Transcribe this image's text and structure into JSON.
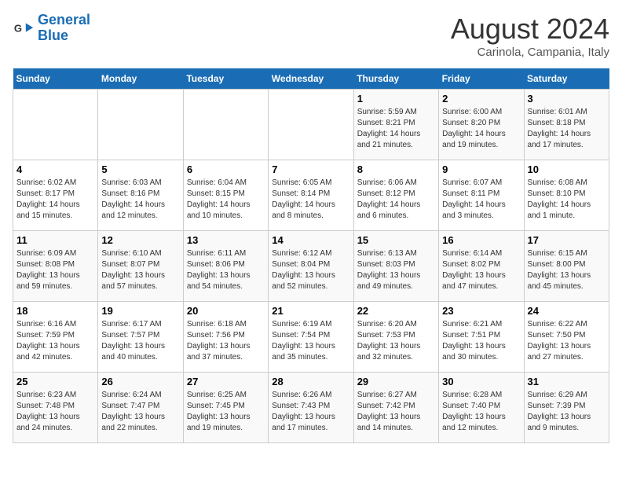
{
  "header": {
    "logo_line1": "General",
    "logo_line2": "Blue",
    "month_year": "August 2024",
    "location": "Carinola, Campania, Italy"
  },
  "days_of_week": [
    "Sunday",
    "Monday",
    "Tuesday",
    "Wednesday",
    "Thursday",
    "Friday",
    "Saturday"
  ],
  "weeks": [
    [
      {
        "day": "",
        "info": ""
      },
      {
        "day": "",
        "info": ""
      },
      {
        "day": "",
        "info": ""
      },
      {
        "day": "",
        "info": ""
      },
      {
        "day": "1",
        "info": "Sunrise: 5:59 AM\nSunset: 8:21 PM\nDaylight: 14 hours\nand 21 minutes."
      },
      {
        "day": "2",
        "info": "Sunrise: 6:00 AM\nSunset: 8:20 PM\nDaylight: 14 hours\nand 19 minutes."
      },
      {
        "day": "3",
        "info": "Sunrise: 6:01 AM\nSunset: 8:18 PM\nDaylight: 14 hours\nand 17 minutes."
      }
    ],
    [
      {
        "day": "4",
        "info": "Sunrise: 6:02 AM\nSunset: 8:17 PM\nDaylight: 14 hours\nand 15 minutes."
      },
      {
        "day": "5",
        "info": "Sunrise: 6:03 AM\nSunset: 8:16 PM\nDaylight: 14 hours\nand 12 minutes."
      },
      {
        "day": "6",
        "info": "Sunrise: 6:04 AM\nSunset: 8:15 PM\nDaylight: 14 hours\nand 10 minutes."
      },
      {
        "day": "7",
        "info": "Sunrise: 6:05 AM\nSunset: 8:14 PM\nDaylight: 14 hours\nand 8 minutes."
      },
      {
        "day": "8",
        "info": "Sunrise: 6:06 AM\nSunset: 8:12 PM\nDaylight: 14 hours\nand 6 minutes."
      },
      {
        "day": "9",
        "info": "Sunrise: 6:07 AM\nSunset: 8:11 PM\nDaylight: 14 hours\nand 3 minutes."
      },
      {
        "day": "10",
        "info": "Sunrise: 6:08 AM\nSunset: 8:10 PM\nDaylight: 14 hours\nand 1 minute."
      }
    ],
    [
      {
        "day": "11",
        "info": "Sunrise: 6:09 AM\nSunset: 8:08 PM\nDaylight: 13 hours\nand 59 minutes."
      },
      {
        "day": "12",
        "info": "Sunrise: 6:10 AM\nSunset: 8:07 PM\nDaylight: 13 hours\nand 57 minutes."
      },
      {
        "day": "13",
        "info": "Sunrise: 6:11 AM\nSunset: 8:06 PM\nDaylight: 13 hours\nand 54 minutes."
      },
      {
        "day": "14",
        "info": "Sunrise: 6:12 AM\nSunset: 8:04 PM\nDaylight: 13 hours\nand 52 minutes."
      },
      {
        "day": "15",
        "info": "Sunrise: 6:13 AM\nSunset: 8:03 PM\nDaylight: 13 hours\nand 49 minutes."
      },
      {
        "day": "16",
        "info": "Sunrise: 6:14 AM\nSunset: 8:02 PM\nDaylight: 13 hours\nand 47 minutes."
      },
      {
        "day": "17",
        "info": "Sunrise: 6:15 AM\nSunset: 8:00 PM\nDaylight: 13 hours\nand 45 minutes."
      }
    ],
    [
      {
        "day": "18",
        "info": "Sunrise: 6:16 AM\nSunset: 7:59 PM\nDaylight: 13 hours\nand 42 minutes."
      },
      {
        "day": "19",
        "info": "Sunrise: 6:17 AM\nSunset: 7:57 PM\nDaylight: 13 hours\nand 40 minutes."
      },
      {
        "day": "20",
        "info": "Sunrise: 6:18 AM\nSunset: 7:56 PM\nDaylight: 13 hours\nand 37 minutes."
      },
      {
        "day": "21",
        "info": "Sunrise: 6:19 AM\nSunset: 7:54 PM\nDaylight: 13 hours\nand 35 minutes."
      },
      {
        "day": "22",
        "info": "Sunrise: 6:20 AM\nSunset: 7:53 PM\nDaylight: 13 hours\nand 32 minutes."
      },
      {
        "day": "23",
        "info": "Sunrise: 6:21 AM\nSunset: 7:51 PM\nDaylight: 13 hours\nand 30 minutes."
      },
      {
        "day": "24",
        "info": "Sunrise: 6:22 AM\nSunset: 7:50 PM\nDaylight: 13 hours\nand 27 minutes."
      }
    ],
    [
      {
        "day": "25",
        "info": "Sunrise: 6:23 AM\nSunset: 7:48 PM\nDaylight: 13 hours\nand 24 minutes."
      },
      {
        "day": "26",
        "info": "Sunrise: 6:24 AM\nSunset: 7:47 PM\nDaylight: 13 hours\nand 22 minutes."
      },
      {
        "day": "27",
        "info": "Sunrise: 6:25 AM\nSunset: 7:45 PM\nDaylight: 13 hours\nand 19 minutes."
      },
      {
        "day": "28",
        "info": "Sunrise: 6:26 AM\nSunset: 7:43 PM\nDaylight: 13 hours\nand 17 minutes."
      },
      {
        "day": "29",
        "info": "Sunrise: 6:27 AM\nSunset: 7:42 PM\nDaylight: 13 hours\nand 14 minutes."
      },
      {
        "day": "30",
        "info": "Sunrise: 6:28 AM\nSunset: 7:40 PM\nDaylight: 13 hours\nand 12 minutes."
      },
      {
        "day": "31",
        "info": "Sunrise: 6:29 AM\nSunset: 7:39 PM\nDaylight: 13 hours\nand 9 minutes."
      }
    ]
  ]
}
